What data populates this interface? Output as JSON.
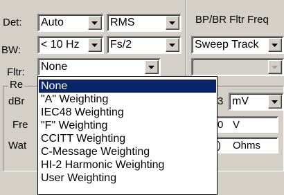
{
  "detector": {
    "label": "Det:",
    "value1": "Auto",
    "value2": "RMS"
  },
  "bandwidth": {
    "label": "BW:",
    "value1": "< 10 Hz",
    "value2": "Fs/2"
  },
  "filter": {
    "label": "Fltr:",
    "value": "None"
  },
  "bp_br": {
    "header": "BP/BR Fltr Freq",
    "mode": "Sweep Track"
  },
  "reference": {
    "group_label": "Re",
    "dbr_label": "dBr",
    "dbr_unit": "mV",
    "freq_label": "Fre",
    "freq_unit": "V",
    "watts_label": "Wat",
    "watts_unit": "Ohms",
    "dbr_prefix": "3",
    "freq_prefix": "0",
    "watts_prefix": ")"
  },
  "filter_options": [
    "None",
    "\"A\" Weighting",
    "IEC48 Weighting",
    "\"F\" Weighting",
    "CCITT Weighting",
    "C-Message Weighting",
    "HI-2 Harmonic Weighting",
    "User Weighting"
  ]
}
